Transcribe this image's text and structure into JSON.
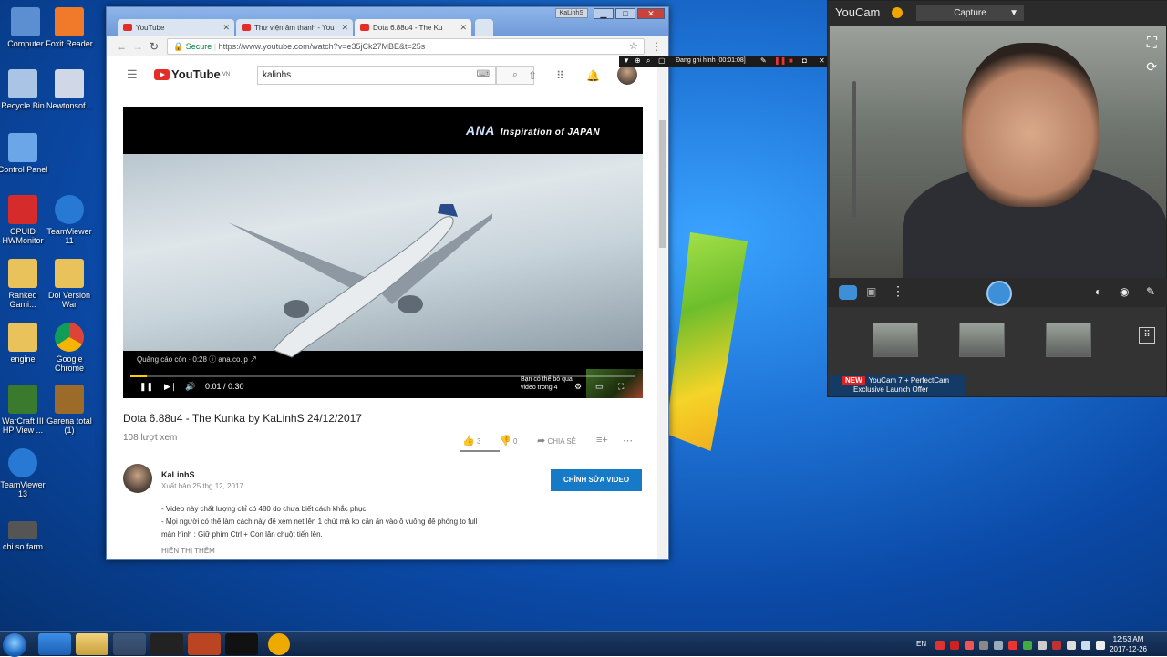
{
  "desktop": {
    "icons": [
      {
        "label": "Computer",
        "color": "#5b8fd1"
      },
      {
        "label": "Foxit Reader",
        "color": "#f07a2a"
      },
      {
        "label": "Recycle Bin",
        "color": "#a9c4e4"
      },
      {
        "label": "Newtonsof...",
        "color": "#d0d8e8"
      },
      {
        "label": "Control Panel",
        "color": "#6aa6e8"
      },
      {
        "label": "CPUID HWMonitor",
        "color": "#d62b2b"
      },
      {
        "label": "TeamViewer 11",
        "color": "#2779d3"
      },
      {
        "label": "Ranked Gami...",
        "color": "#e9c25b"
      },
      {
        "label": "Doi Version War",
        "color": "#e9c25b"
      },
      {
        "label": "engine",
        "color": "#e9c25b"
      },
      {
        "label": "Google Chrome",
        "color": "#4caf50"
      },
      {
        "label": "WarCraft III HP View ...",
        "color": "#3a7a2e"
      },
      {
        "label": "Garena total (1)",
        "color": "#9c6b2a"
      },
      {
        "label": "TeamViewer 13",
        "color": "#2779d3"
      },
      {
        "label": "chi so farm",
        "color": "#555"
      }
    ]
  },
  "browser": {
    "tabs": [
      {
        "label": "YouTube"
      },
      {
        "label": "Thư viện âm thanh - You"
      },
      {
        "label": "Dota 6.88u4 - The Ku"
      }
    ],
    "user_badge": "KaLinhS",
    "secure_label": "Secure",
    "url": "https://www.youtube.com/watch?v=e35jCk27MBE&t=25s",
    "search_value": "kalinhs",
    "logo_text": "YouTube",
    "logo_region": "VN"
  },
  "video": {
    "ad_brand": "ANA",
    "ad_tagline": "Inspiration of JAPAN",
    "skip_text_1": "Bạn có thể bỏ qua",
    "skip_text_2": "video trong 4",
    "ad_info": "Quảng cáo còn · 0:28 ⓘ  ana.co.jp ↗",
    "time": "0:01 / 0:30",
    "progress_fraction": 0.033
  },
  "meta": {
    "title": "Dota 6.88u4 - The Kunka by KaLinhS 24/12/2017",
    "views": "108 lượt xem",
    "likes": "3",
    "dislikes": "0",
    "share": "CHIA SẺ",
    "channel": "KaLinhS",
    "published": "Xuất bản 25 thg 12, 2017",
    "edit_button": "CHỈNH SỬA VIDEO",
    "description": [
      "- Video này chất lượng chỉ có 480 do chưa biết cách khắc phục.",
      "- Mọi người có thể làm cách này để xem net lên 1 chút mà ko cần ấn vào ô vuông để phóng to full",
      "màn hình : Giữ phím Ctrl + Con lăn chuột tiến lên."
    ],
    "show_more": "HIỂN THỊ THÊM"
  },
  "recorder": {
    "label": "Đang ghi hình [00:01:08]"
  },
  "youcam": {
    "title": "YouCam",
    "mode": "Capture",
    "promo_new": "NEW",
    "promo_line1": "YouCam 7 + PerfectCam",
    "promo_line2": "Exclusive Launch Offer"
  },
  "taskbar": {
    "language": "EN",
    "time": "12:53 AM",
    "date": "2017-12-26"
  }
}
